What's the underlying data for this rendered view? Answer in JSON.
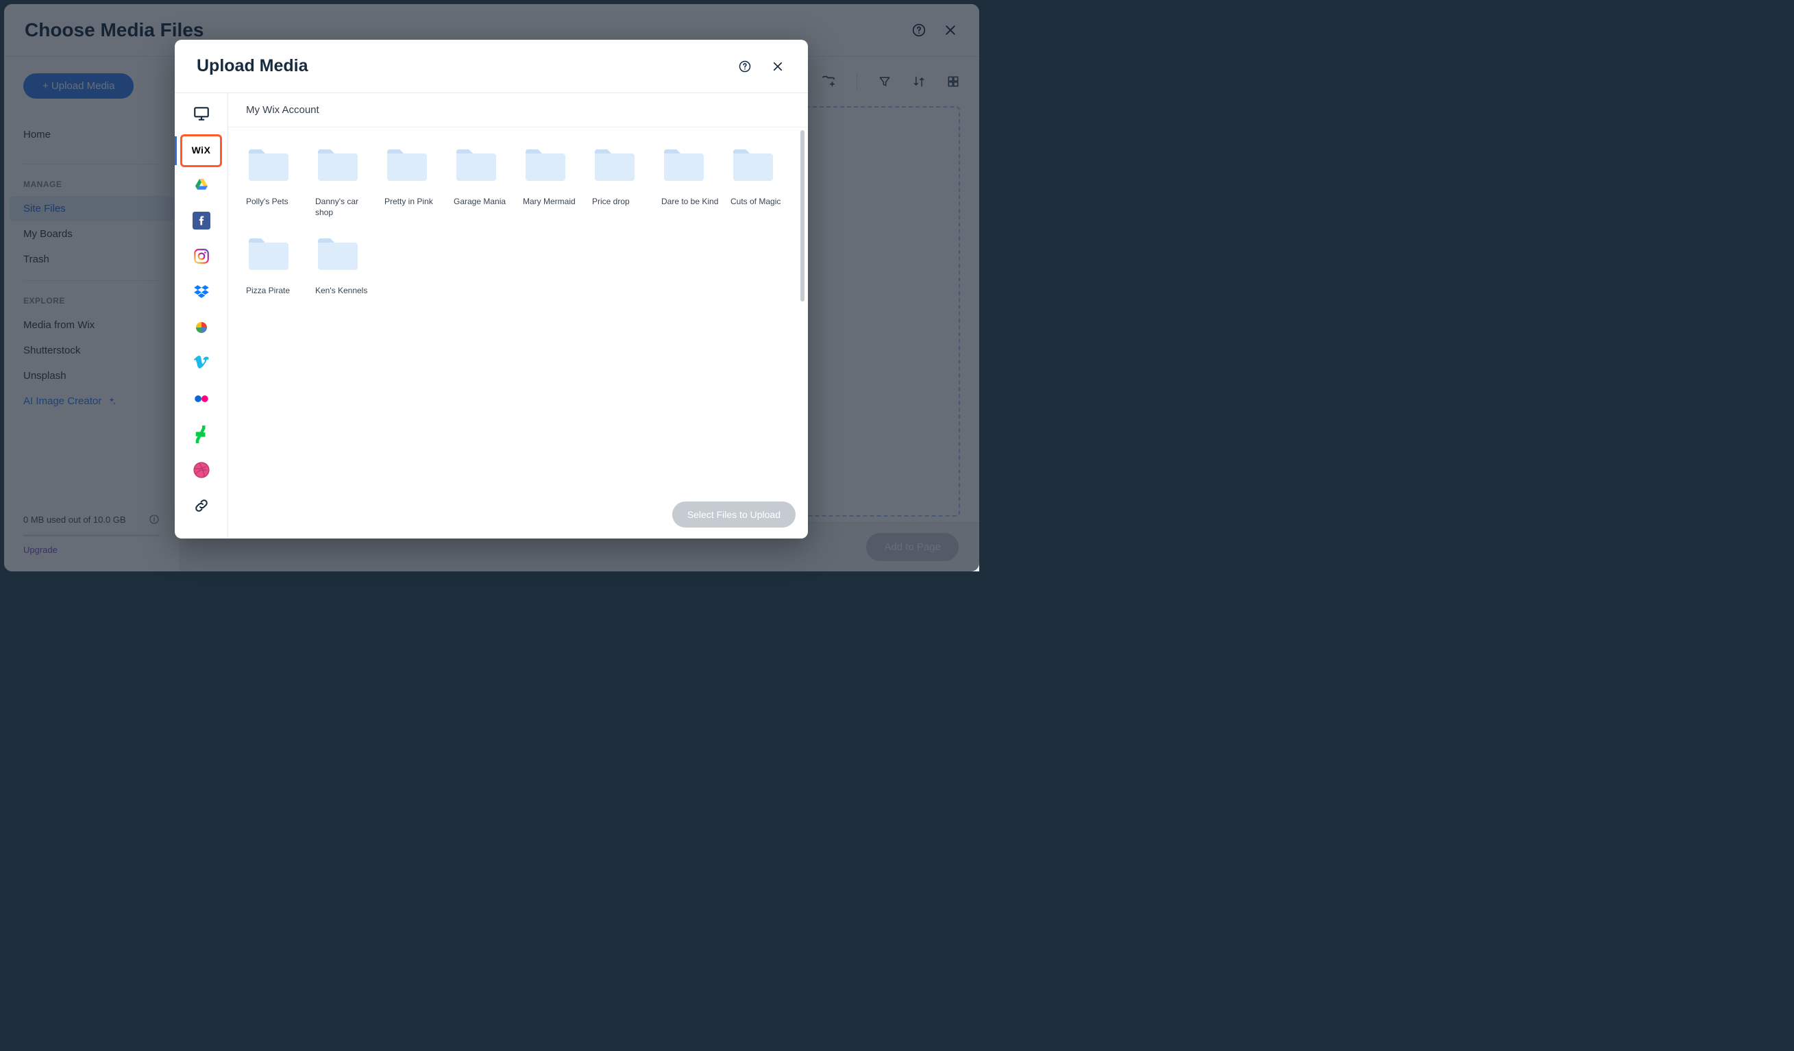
{
  "outer": {
    "title": "Choose Media Files",
    "upload_button": "+ Upload Media",
    "nav_home": "Home",
    "section_manage": "MANAGE",
    "section_explore": "EXPLORE",
    "manage_items": [
      "Site Files",
      "My Boards",
      "Trash"
    ],
    "explore_items": [
      "Media from Wix",
      "Shutterstock",
      "Unsplash"
    ],
    "ai_creator": "AI Image Creator",
    "storage_text": "0 MB used out of 10.0 GB",
    "upgrade": "Upgrade",
    "add_to_page": "Add to Page"
  },
  "inner": {
    "title": "Upload Media",
    "account_label": "My Wix Account",
    "select_btn": "Select Files to Upload",
    "sources": [
      {
        "id": "my-computer",
        "name": "computer-icon"
      },
      {
        "id": "wix",
        "name": "wix-icon"
      },
      {
        "id": "google-drive",
        "name": "google-drive-icon"
      },
      {
        "id": "facebook",
        "name": "facebook-icon"
      },
      {
        "id": "instagram",
        "name": "instagram-icon"
      },
      {
        "id": "dropbox",
        "name": "dropbox-icon"
      },
      {
        "id": "google-photos",
        "name": "google-photos-icon"
      },
      {
        "id": "vimeo",
        "name": "vimeo-icon"
      },
      {
        "id": "flickr",
        "name": "flickr-icon"
      },
      {
        "id": "deviantart",
        "name": "deviantart-icon"
      },
      {
        "id": "dribbble",
        "name": "dribbble-icon"
      },
      {
        "id": "link-url",
        "name": "link-icon"
      }
    ],
    "folders": [
      "Polly's Pets",
      "Danny's car shop",
      "Pretty in Pink",
      "Garage Mania",
      "Mary Mermaid",
      "Price drop",
      "Dare to be Kind",
      "Cuts of Magic",
      "Pizza Pirate",
      "Ken's Kennels"
    ]
  }
}
